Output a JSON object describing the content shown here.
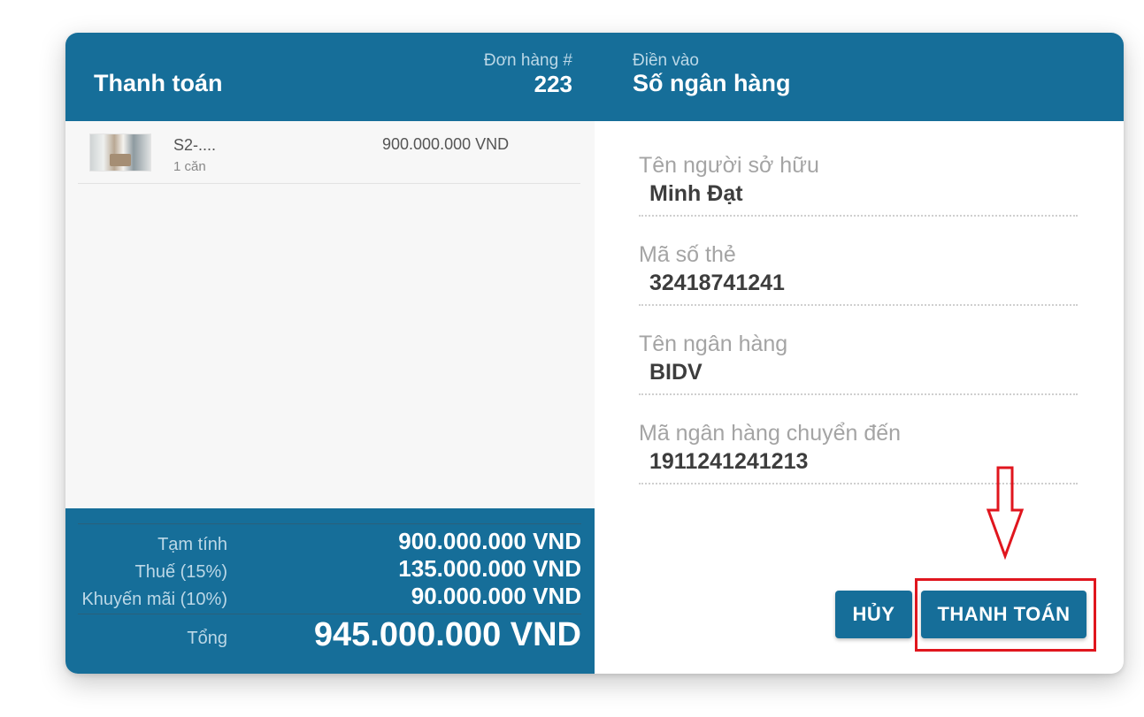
{
  "header": {
    "title": "Thanh toán",
    "order_caption": "Đơn hàng #",
    "order_number": "223",
    "fill_caption": "Điền vào",
    "fill_title": "Số ngân hàng"
  },
  "cart": {
    "items": [
      {
        "name": "S2-....",
        "quantity": "1 căn",
        "price": "900.000.000 VND"
      }
    ]
  },
  "totals": {
    "subtotal_label": "Tạm tính",
    "subtotal_value": "900.000.000 VND",
    "tax_label": "Thuế (15%)",
    "tax_value": "135.000.000 VND",
    "discount_label": "Khuyến mãi (10%)",
    "discount_value": "90.000.000 VND",
    "total_label": "Tổng",
    "total_value": "945.000.000 VND"
  },
  "form": {
    "owner_label": "Tên người sở hữu",
    "owner_value": "Minh Đạt",
    "card_label": "Mã số thẻ",
    "card_value": "32418741241",
    "bank_label": "Tên ngân hàng",
    "bank_value": "BIDV",
    "transfer_label": "Mã ngân hàng chuyển đến",
    "transfer_value": "1911241241213"
  },
  "actions": {
    "cancel_label": "HỦY",
    "pay_label": "THANH TOÁN"
  },
  "colors": {
    "primary": "#166e99",
    "highlight": "#e0161e"
  },
  "icons": {
    "annotation_arrow": "down-arrow-icon",
    "product_thumbnail": "room-photo"
  }
}
